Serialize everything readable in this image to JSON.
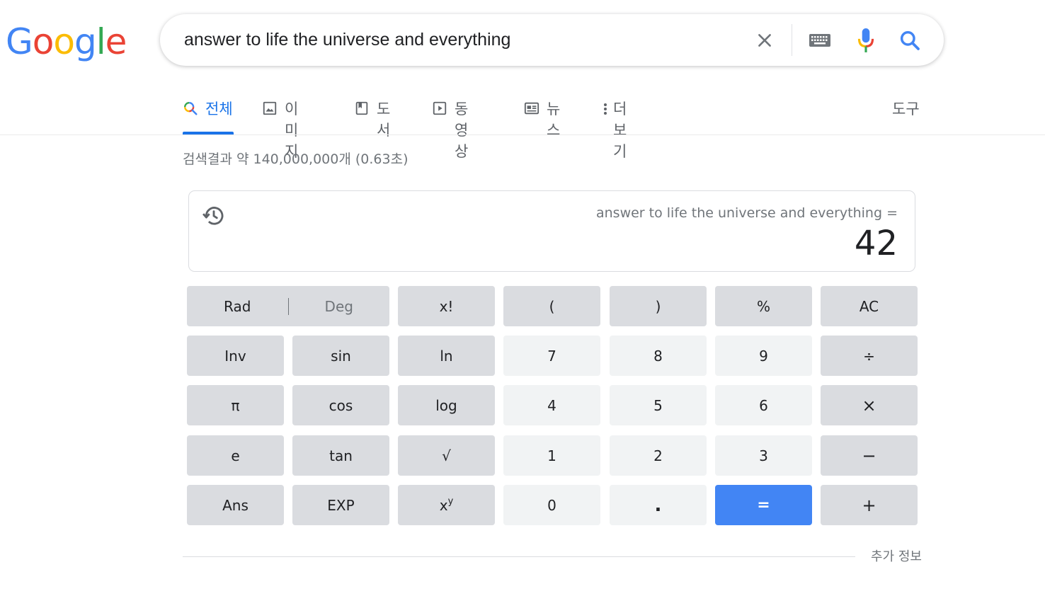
{
  "logo": {
    "letters": [
      "G",
      "o",
      "o",
      "g",
      "l",
      "e"
    ],
    "colors": [
      "#4285F4",
      "#EA4335",
      "#FBBC05",
      "#4285F4",
      "#34A853",
      "#EA4335"
    ]
  },
  "search": {
    "query": "answer to life the universe and everything"
  },
  "tabs": [
    {
      "label": "전체",
      "icon": "search-icon",
      "active": true
    },
    {
      "label": "이미지",
      "icon": "image-icon",
      "active": false
    },
    {
      "label": "도서",
      "icon": "book-icon",
      "active": false
    },
    {
      "label": "동영상",
      "icon": "video-icon",
      "active": false
    },
    {
      "label": "뉴스",
      "icon": "news-icon",
      "active": false
    },
    {
      "label": "더보기",
      "icon": "more-vert-icon",
      "active": false
    }
  ],
  "tools_label": "도구",
  "stats": "검색결과 약 140,000,000개 (0.63초)",
  "calculator": {
    "expression": "answer to life the universe and everything =",
    "result": "42",
    "rad_label": "Rad",
    "deg_label": "Deg",
    "keys": {
      "fact": "x!",
      "lparen": "(",
      "rparen": ")",
      "percent": "%",
      "ac": "AC",
      "inv": "Inv",
      "sin": "sin",
      "ln": "ln",
      "k7": "7",
      "k8": "8",
      "k9": "9",
      "divide": "÷",
      "pi": "π",
      "cos": "cos",
      "log": "log",
      "k4": "4",
      "k5": "5",
      "k6": "6",
      "multiply": "×",
      "e": "e",
      "tan": "tan",
      "sqrt": "√",
      "k1": "1",
      "k2": "2",
      "k3": "3",
      "minus": "−",
      "ans": "Ans",
      "exp": "EXP",
      "k0": "0",
      "dot": ".",
      "equals": "=",
      "plus": "+"
    },
    "power_base": "x",
    "power_exp": "y"
  },
  "more_info": "추가 정보",
  "colors": {
    "accent": "#1a73e8",
    "equals_key": "#4285f4",
    "op_key": "#dadce0",
    "num_key": "#f1f3f4"
  }
}
